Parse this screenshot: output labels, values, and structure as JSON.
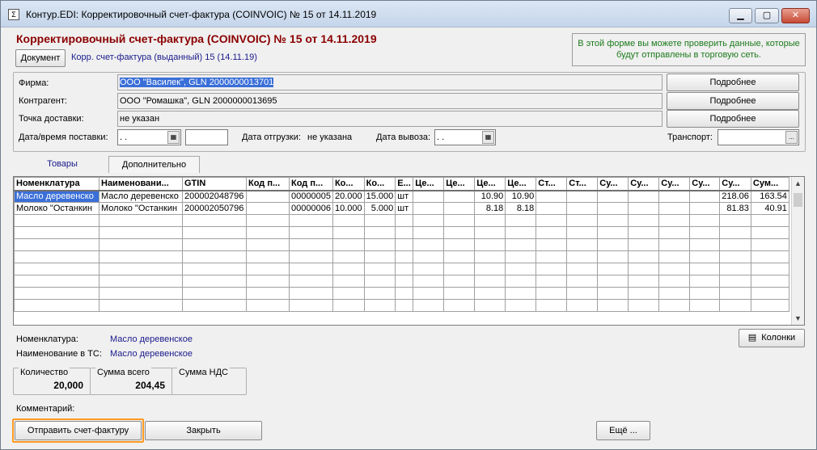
{
  "window": {
    "title": "Контур.EDI: Корректировочный счет-фактура (COINVOIC) № 15 от 14.11.2019",
    "app_icon": "doc-icon",
    "controls": [
      "minimize",
      "maximize",
      "close"
    ]
  },
  "header": {
    "title": "Корректировочный счет-фактура (COINVOIC) № 15 от 14.11.2019",
    "document_button": "Документ",
    "document_link": "Корр. счет-фактура (выданный) 15 (14.11.19)",
    "info_text": "В этой форме вы можете проверить данные, которые будут отправлены в торговую сеть."
  },
  "form": {
    "firm_label": "Фирма:",
    "firm_value": "ООО \"Василек\", GLN 2000000013701",
    "contractor_label": "Контрагент:",
    "contractor_value": "ООО \"Ромашка\", GLN 2000000013695",
    "delivery_point_label": "Точка доставки:",
    "delivery_point_value": "не указан",
    "details_button": "Подробнее",
    "delivery_datetime_label": "Дата/время поставки:",
    "delivery_date_value": " .  .",
    "delivery_time_value": "",
    "shipment_date_label": "Дата отгрузки:",
    "shipment_date_value": "не указана",
    "pickup_date_label": "Дата вывоза:",
    "pickup_date_value": " .  .",
    "transport_label": "Транспорт:",
    "transport_value": "",
    "transport_button": "..."
  },
  "tabs": [
    {
      "label": "Товары",
      "active": true
    },
    {
      "label": "Дополнительно",
      "active": false
    }
  ],
  "grid": {
    "columns": [
      "Номенклатура",
      "Наименовани...",
      "GTIN",
      "Код п...",
      "Код п...",
      "Ко...",
      "Ко...",
      "Е...",
      "Це...",
      "Це...",
      "Це...",
      "Це...",
      "Ст...",
      "Ст...",
      "Су...",
      "Су...",
      "Су...",
      "Су...",
      "Су...",
      "Сум..."
    ],
    "rows": [
      [
        "Масло деревенско",
        "Масло деревенско",
        "200002048796",
        "",
        "00000005",
        "20.000",
        "15.000",
        "шт",
        "",
        "",
        "10.90",
        "10.90",
        "",
        "",
        "",
        "",
        "",
        "",
        "218.06",
        "163.54"
      ],
      [
        "Молоко \"Останкин",
        "Молоко \"Останкин",
        "200002050796",
        "",
        "00000006",
        "10.000",
        "5.000",
        "шт",
        "",
        "",
        "8.18",
        "8.18",
        "",
        "",
        "",
        "",
        "",
        "",
        "81.83",
        "40.91"
      ]
    ]
  },
  "details": {
    "nomenclature_label": "Номенклатура:",
    "nomenclature_value": "Масло деревенское",
    "ts_name_label": "Наименование в ТС:",
    "ts_name_value": "Масло деревенское",
    "columns_button": "Колонки"
  },
  "totals": {
    "quantity_label": "Количество",
    "quantity_value": "20,000",
    "sum_label": "Сумма всего",
    "sum_value": "204,45",
    "vat_label": "Сумма НДС",
    "vat_value": ""
  },
  "comment_label": "Комментарий:",
  "footer": {
    "send_button": "Отправить счет-фактуру",
    "close_button": "Закрыть",
    "more_button": "Ещё ..."
  }
}
